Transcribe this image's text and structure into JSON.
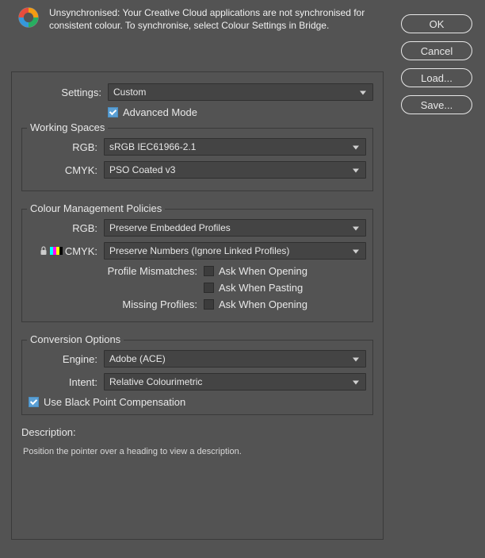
{
  "warning": {
    "text": "Unsynchronised: Your Creative Cloud applications are not synchronised for consistent colour. To synchronise, select Colour Settings in Bridge."
  },
  "buttons": {
    "ok": "OK",
    "cancel": "Cancel",
    "load": "Load...",
    "save": "Save..."
  },
  "settings": {
    "label": "Settings:",
    "value": "Custom",
    "advancedMode": {
      "label": "Advanced Mode",
      "checked": true
    }
  },
  "workingSpaces": {
    "title": "Working Spaces",
    "rgb": {
      "label": "RGB:",
      "value": "sRGB IEC61966-2.1"
    },
    "cmyk": {
      "label": "CMYK:",
      "value": "PSO Coated v3"
    }
  },
  "policies": {
    "title": "Colour Management Policies",
    "rgb": {
      "label": "RGB:",
      "value": "Preserve Embedded Profiles"
    },
    "cmyk": {
      "label": "CMYK:",
      "value": "Preserve Numbers (Ignore Linked Profiles)"
    },
    "profileMismatches": {
      "label": "Profile Mismatches:",
      "askOpening": {
        "label": "Ask When Opening",
        "checked": false
      },
      "askPasting": {
        "label": "Ask When Pasting",
        "checked": false
      }
    },
    "missingProfiles": {
      "label": "Missing Profiles:",
      "askOpening": {
        "label": "Ask When Opening",
        "checked": false
      }
    }
  },
  "conversion": {
    "title": "Conversion Options",
    "engine": {
      "label": "Engine:",
      "value": "Adobe (ACE)"
    },
    "intent": {
      "label": "Intent:",
      "value": "Relative Colourimetric"
    },
    "blackPoint": {
      "label": "Use Black Point Compensation",
      "checked": true
    }
  },
  "description": {
    "title": "Description:",
    "text": "Position the pointer over a heading to view a description."
  }
}
